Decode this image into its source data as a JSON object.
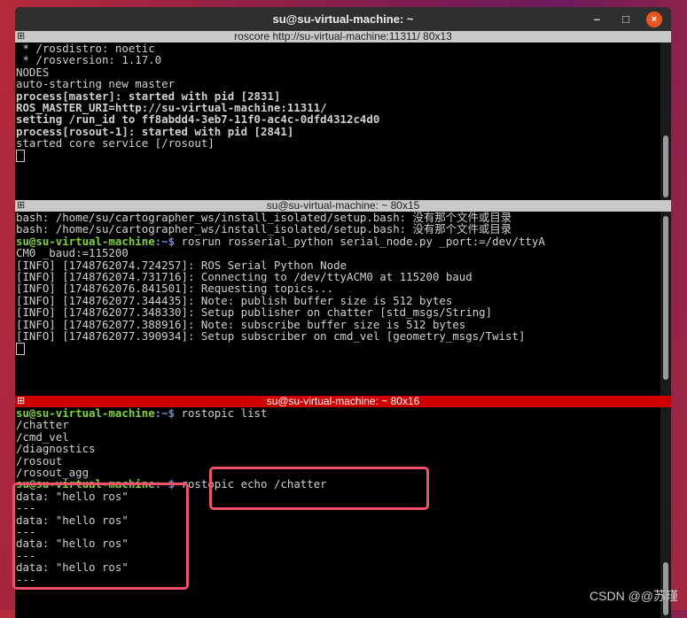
{
  "window": {
    "title": "su@su-virtual-machine: ~",
    "minimize": "–",
    "maximize": "□",
    "close": "×"
  },
  "pane1": {
    "title": "roscore http://su-virtual-machine:11311/ 80x13",
    "lines": [
      " * /rosdistro: noetic",
      " * /rosversion: 1.17.0",
      "",
      "NODES",
      "",
      "auto-starting new master"
    ],
    "bold_lines": [
      "process[master]: started with pid [2831]",
      "ROS_MASTER_URI=http://su-virtual-machine:11311/",
      "",
      "setting /run_id to ff8abdd4-3eb7-11f0-ac4c-0dfd4312c4d0",
      "process[rosout-1]: started with pid [2841]"
    ],
    "tail": "started core service [/rosout]"
  },
  "pane2": {
    "title": "su@su-virtual-machine: ~ 80x15",
    "err1": "bash: /home/su/cartographer_ws/install_isolated/setup.bash: 没有那个文件或目录",
    "err2": "bash: /home/su/cartographer_ws/install_isolated/setup.bash: 没有那个文件或目录",
    "prompt_user": "su@su-virtual-machine",
    "prompt_path": ":~$ ",
    "cmd": "rosrun rosserial_python serial_node.py _port:=/dev/ttyA",
    "cmd_wrap": "CM0 _baud:=115200",
    "info": [
      "[INFO] [1748762074.724257]: ROS Serial Python Node",
      "[INFO] [1748762074.731716]: Connecting to /dev/ttyACM0 at 115200 baud",
      "[INFO] [1748762076.841501]: Requesting topics...",
      "[INFO] [1748762077.344435]: Note: publish buffer size is 512 bytes",
      "[INFO] [1748762077.348330]: Setup publisher on chatter [std_msgs/String]",
      "[INFO] [1748762077.388916]: Note: subscribe buffer size is 512 bytes",
      "[INFO] [1748762077.390934]: Setup subscriber on cmd_vel [geometry_msgs/Twist]"
    ]
  },
  "pane3": {
    "title": "su@su-virtual-machine: ~ 80x16",
    "prompt_user": "su@su-virtual-machine",
    "prompt_path": ":~$ ",
    "cmd1": "rostopic list",
    "topics": [
      "/chatter",
      "/cmd_vel",
      "/diagnostics",
      "/rosout",
      "/rosout_agg"
    ],
    "cmd2": "rostopic echo /chatter",
    "echo": [
      "data: \"hello ros\"",
      "---",
      "data: \"hello ros\"",
      "---",
      "data: \"hello ros\"",
      "---",
      "data: \"hello ros\"",
      "---"
    ]
  },
  "watermark": "CSDN @@苏瑾"
}
